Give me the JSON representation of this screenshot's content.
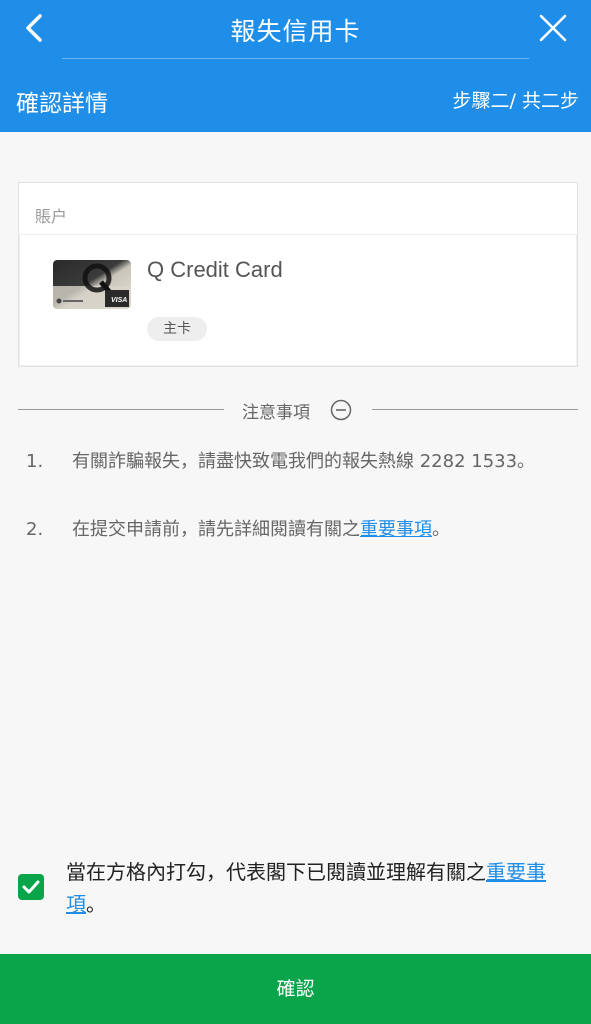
{
  "header": {
    "title": "報失信用卡",
    "subtitle": "確認詳情",
    "step": "步驟二/ 共二步"
  },
  "account": {
    "label": "賬户",
    "card_name": "Q Credit Card",
    "card_badge": "主卡"
  },
  "notes": {
    "title": "注意事項",
    "items": [
      {
        "num": "1.",
        "text": "有關詐騙報失，請盡快致電我們的報失熱線 2282 1533。"
      },
      {
        "num": "2.",
        "text_before": "在提交申請前，請先詳細閱讀有關之",
        "link": "重要事項",
        "text_after": "。"
      }
    ]
  },
  "agreement": {
    "checked": true,
    "text_before": "當在方格內打勾，代表閣下已閱讀並理解有關之",
    "link": "重要事項",
    "text_after": "。"
  },
  "confirm_label": "確認",
  "colors": {
    "header_bg": "#1f8ee8",
    "confirm_bg": "#0aa54a",
    "link": "#1f8ee8"
  }
}
